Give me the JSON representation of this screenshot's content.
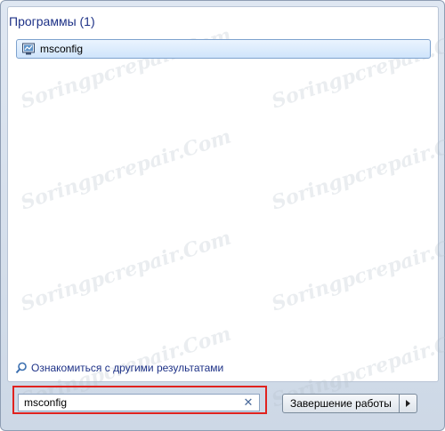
{
  "results": {
    "header": "Программы (1)",
    "items": [
      {
        "label": "msconfig",
        "icon": "system-configuration-icon"
      }
    ]
  },
  "more_results": {
    "label": "Ознакомиться с другими результатами",
    "icon": "search-icon"
  },
  "search": {
    "value": "msconfig",
    "clear_icon": "close-icon"
  },
  "shutdown": {
    "label": "Завершение работы",
    "arrow_icon": "chevron-right-icon"
  },
  "watermark": {
    "text": "Soringpcrepair.Com"
  },
  "colors": {
    "header_text": "#1e3287",
    "highlight_border": "#e0221f",
    "selected_item_bg": "#cfe4fb"
  }
}
